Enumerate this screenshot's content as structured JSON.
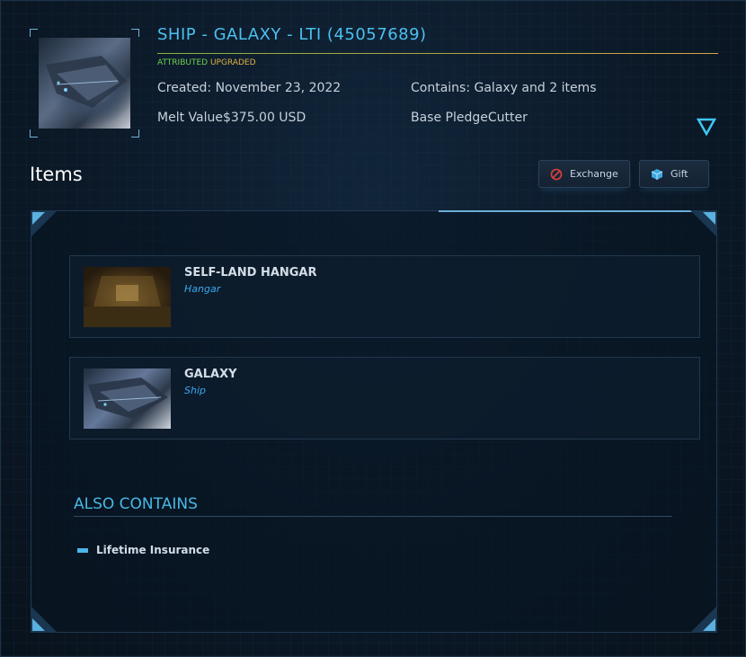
{
  "header": {
    "title": "SHIP - GALAXY - LTI (45057689)",
    "tags": {
      "attributed": "ATTRIBUTED",
      "upgraded": "UPGRADED"
    },
    "created": "Created: November 23, 2022",
    "contains": "Contains: Galaxy and 2 items",
    "melt_value": "Melt Value$375.00 USD",
    "base_pledge": "Base PledgeCutter",
    "expand_icon": "chevron-down-triangle-icon"
  },
  "items_section": {
    "heading": "Items",
    "buttons": {
      "exchange": {
        "label": "Exchange",
        "icon": "no-entry-icon"
      },
      "gift": {
        "label": "Gift",
        "icon": "gift-cube-icon"
      }
    },
    "items": [
      {
        "name": "SELF-LAND HANGAR",
        "type": "Hangar",
        "thumb": "hangar-image"
      },
      {
        "name": "GALAXY",
        "type": "Ship",
        "thumb": "ship-image"
      }
    ]
  },
  "also_contains": {
    "heading": "ALSO CONTAINS",
    "items": [
      "Lifetime Insurance"
    ]
  },
  "colors": {
    "accent": "#4cc0f0",
    "attributed": "#6fd14c",
    "upgraded": "#e0b040",
    "item_type": "#3aa8f0"
  }
}
